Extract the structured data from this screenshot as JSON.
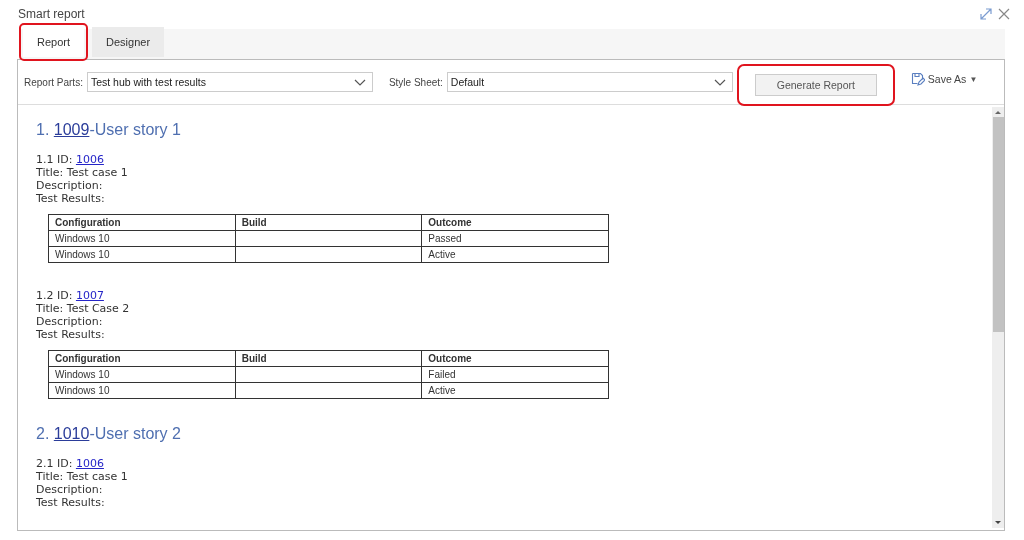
{
  "window": {
    "title": "Smart report"
  },
  "tabs": [
    {
      "label": "Report",
      "selected": true,
      "highlighted": true
    },
    {
      "label": "Designer",
      "selected": false,
      "highlighted": false
    }
  ],
  "toolbar": {
    "report_parts": {
      "label": "Report Parts:",
      "value": "Test hub with test results"
    },
    "style_sheet": {
      "label": "Style Sheet:",
      "value": "Default"
    },
    "generate_button": {
      "label": "Generate Report",
      "highlighted": true
    },
    "save_as": {
      "label": "Save As",
      "caret": "▼"
    }
  },
  "report": [
    {
      "number": "1.",
      "id": "1009",
      "title": "-User story 1",
      "cases": [
        {
          "prefix": "1.1 ID:",
          "id": "1006",
          "title": "Title: Test case 1",
          "description": "Description:",
          "results": "Test Results:",
          "columns": [
            "Configuration",
            "Build",
            "Outcome"
          ],
          "rows": [
            [
              "Windows 10",
              "",
              "Passed"
            ],
            [
              "Windows 10",
              "",
              "Active"
            ]
          ]
        },
        {
          "prefix": "1.2 ID:",
          "id": "1007",
          "title": "Title: Test Case 2",
          "description": "Description:",
          "results": "Test Results:",
          "columns": [
            "Configuration",
            "Build",
            "Outcome"
          ],
          "rows": [
            [
              "Windows 10",
              "",
              "Failed"
            ],
            [
              "Windows 10",
              "",
              "Active"
            ]
          ]
        }
      ]
    },
    {
      "number": "2.",
      "id": "1010",
      "title": "-User story 2",
      "cases": [
        {
          "prefix": "2.1 ID:",
          "id": "1006",
          "title": "Title: Test case 1",
          "description": "Description:",
          "results": "Test Results:"
        }
      ]
    }
  ]
}
